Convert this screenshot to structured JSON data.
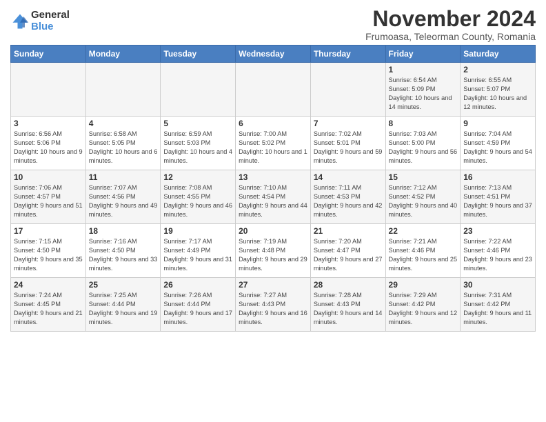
{
  "logo": {
    "general": "General",
    "blue": "Blue"
  },
  "title": "November 2024",
  "location": "Frumoasa, Teleorman County, Romania",
  "days_of_week": [
    "Sunday",
    "Monday",
    "Tuesday",
    "Wednesday",
    "Thursday",
    "Friday",
    "Saturday"
  ],
  "weeks": [
    [
      {
        "day": "",
        "info": ""
      },
      {
        "day": "",
        "info": ""
      },
      {
        "day": "",
        "info": ""
      },
      {
        "day": "",
        "info": ""
      },
      {
        "day": "",
        "info": ""
      },
      {
        "day": "1",
        "info": "Sunrise: 6:54 AM\nSunset: 5:09 PM\nDaylight: 10 hours and 14 minutes."
      },
      {
        "day": "2",
        "info": "Sunrise: 6:55 AM\nSunset: 5:07 PM\nDaylight: 10 hours and 12 minutes."
      }
    ],
    [
      {
        "day": "3",
        "info": "Sunrise: 6:56 AM\nSunset: 5:06 PM\nDaylight: 10 hours and 9 minutes."
      },
      {
        "day": "4",
        "info": "Sunrise: 6:58 AM\nSunset: 5:05 PM\nDaylight: 10 hours and 6 minutes."
      },
      {
        "day": "5",
        "info": "Sunrise: 6:59 AM\nSunset: 5:03 PM\nDaylight: 10 hours and 4 minutes."
      },
      {
        "day": "6",
        "info": "Sunrise: 7:00 AM\nSunset: 5:02 PM\nDaylight: 10 hours and 1 minute."
      },
      {
        "day": "7",
        "info": "Sunrise: 7:02 AM\nSunset: 5:01 PM\nDaylight: 9 hours and 59 minutes."
      },
      {
        "day": "8",
        "info": "Sunrise: 7:03 AM\nSunset: 5:00 PM\nDaylight: 9 hours and 56 minutes."
      },
      {
        "day": "9",
        "info": "Sunrise: 7:04 AM\nSunset: 4:59 PM\nDaylight: 9 hours and 54 minutes."
      }
    ],
    [
      {
        "day": "10",
        "info": "Sunrise: 7:06 AM\nSunset: 4:57 PM\nDaylight: 9 hours and 51 minutes."
      },
      {
        "day": "11",
        "info": "Sunrise: 7:07 AM\nSunset: 4:56 PM\nDaylight: 9 hours and 49 minutes."
      },
      {
        "day": "12",
        "info": "Sunrise: 7:08 AM\nSunset: 4:55 PM\nDaylight: 9 hours and 46 minutes."
      },
      {
        "day": "13",
        "info": "Sunrise: 7:10 AM\nSunset: 4:54 PM\nDaylight: 9 hours and 44 minutes."
      },
      {
        "day": "14",
        "info": "Sunrise: 7:11 AM\nSunset: 4:53 PM\nDaylight: 9 hours and 42 minutes."
      },
      {
        "day": "15",
        "info": "Sunrise: 7:12 AM\nSunset: 4:52 PM\nDaylight: 9 hours and 40 minutes."
      },
      {
        "day": "16",
        "info": "Sunrise: 7:13 AM\nSunset: 4:51 PM\nDaylight: 9 hours and 37 minutes."
      }
    ],
    [
      {
        "day": "17",
        "info": "Sunrise: 7:15 AM\nSunset: 4:50 PM\nDaylight: 9 hours and 35 minutes."
      },
      {
        "day": "18",
        "info": "Sunrise: 7:16 AM\nSunset: 4:50 PM\nDaylight: 9 hours and 33 minutes."
      },
      {
        "day": "19",
        "info": "Sunrise: 7:17 AM\nSunset: 4:49 PM\nDaylight: 9 hours and 31 minutes."
      },
      {
        "day": "20",
        "info": "Sunrise: 7:19 AM\nSunset: 4:48 PM\nDaylight: 9 hours and 29 minutes."
      },
      {
        "day": "21",
        "info": "Sunrise: 7:20 AM\nSunset: 4:47 PM\nDaylight: 9 hours and 27 minutes."
      },
      {
        "day": "22",
        "info": "Sunrise: 7:21 AM\nSunset: 4:46 PM\nDaylight: 9 hours and 25 minutes."
      },
      {
        "day": "23",
        "info": "Sunrise: 7:22 AM\nSunset: 4:46 PM\nDaylight: 9 hours and 23 minutes."
      }
    ],
    [
      {
        "day": "24",
        "info": "Sunrise: 7:24 AM\nSunset: 4:45 PM\nDaylight: 9 hours and 21 minutes."
      },
      {
        "day": "25",
        "info": "Sunrise: 7:25 AM\nSunset: 4:44 PM\nDaylight: 9 hours and 19 minutes."
      },
      {
        "day": "26",
        "info": "Sunrise: 7:26 AM\nSunset: 4:44 PM\nDaylight: 9 hours and 17 minutes."
      },
      {
        "day": "27",
        "info": "Sunrise: 7:27 AM\nSunset: 4:43 PM\nDaylight: 9 hours and 16 minutes."
      },
      {
        "day": "28",
        "info": "Sunrise: 7:28 AM\nSunset: 4:43 PM\nDaylight: 9 hours and 14 minutes."
      },
      {
        "day": "29",
        "info": "Sunrise: 7:29 AM\nSunset: 4:42 PM\nDaylight: 9 hours and 12 minutes."
      },
      {
        "day": "30",
        "info": "Sunrise: 7:31 AM\nSunset: 4:42 PM\nDaylight: 9 hours and 11 minutes."
      }
    ]
  ]
}
